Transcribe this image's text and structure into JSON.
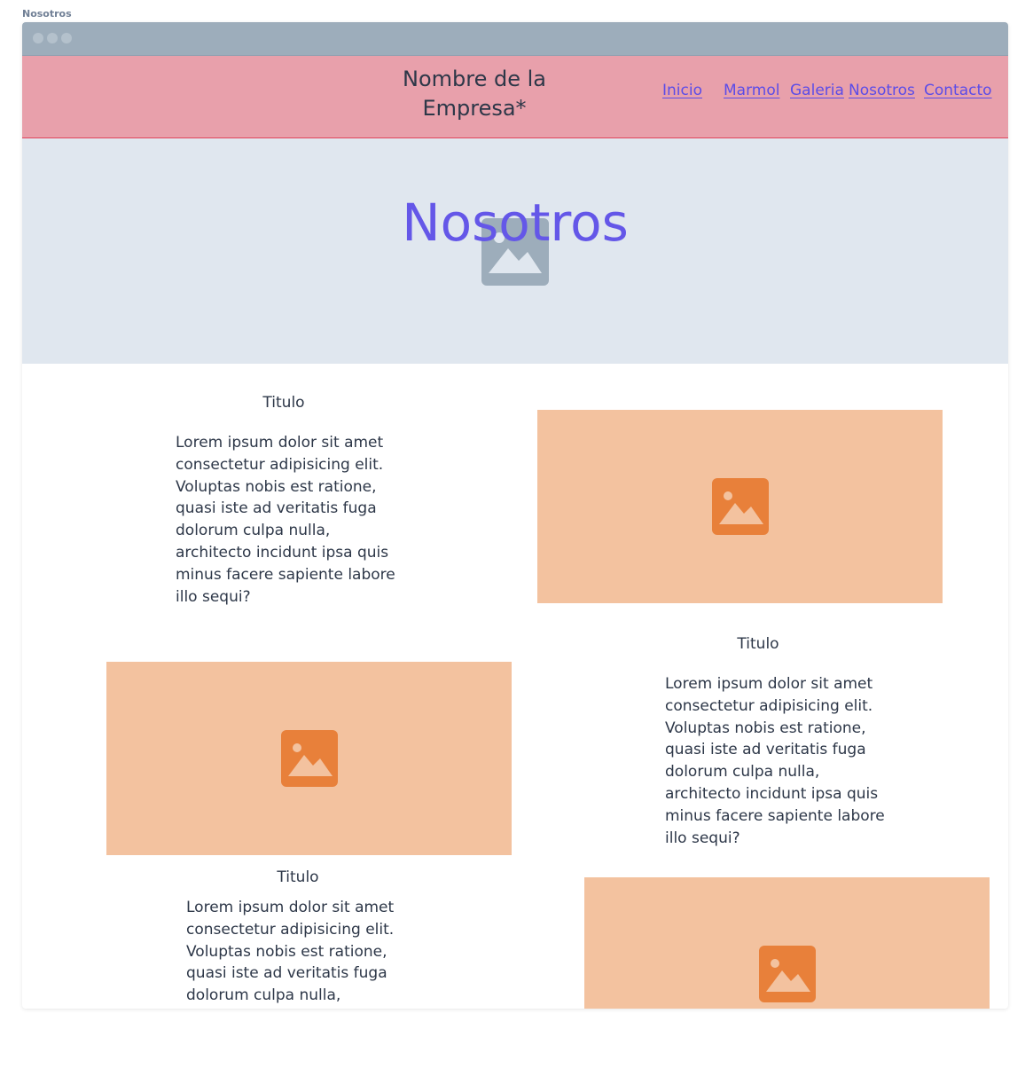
{
  "frame_label": "Nosotros",
  "header": {
    "brand": "Nombre de la Empresa*",
    "nav": [
      "Inicio",
      "Marmol",
      "Galeria",
      "Nosotros",
      "Contacto"
    ]
  },
  "hero": {
    "title": "Nosotros",
    "image_icon": "image-icon"
  },
  "sections": [
    {
      "title": "Titulo",
      "body": "    Lorem ipsum dolor sit amet\nconsectetur adipisicing elit.\nVoluptas nobis est ratione,\nquasi iste ad veritatis fuga\n    dolorum culpa nulla,\narchitecto incidunt ipsa quis\nminus facere sapiente labore\nillo sequi?"
    },
    {
      "title": "Titulo",
      "body": "    Lorem ipsum dolor sit amet\nconsectetur adipisicing elit.\nVoluptas nobis est ratione,\nquasi iste ad veritatis fuga\n    dolorum culpa nulla,\narchitecto incidunt ipsa quis\nminus facere sapiente labore\nillo sequi?"
    },
    {
      "title": "Titulo",
      "body": "    Lorem ipsum dolor sit amet\nconsectetur adipisicing elit.\nVoluptas nobis est ratione,\nquasi iste ad veritatis fuga\n    dolorum culpa nulla,"
    }
  ],
  "colors": {
    "header_bg": "#e8a0ab",
    "header_border": "#e0455c",
    "hero_bg": "#e0e7ef",
    "accent": "#6457e8",
    "image_placeholder": "#f3c29f",
    "image_icon": "#e8803a"
  }
}
